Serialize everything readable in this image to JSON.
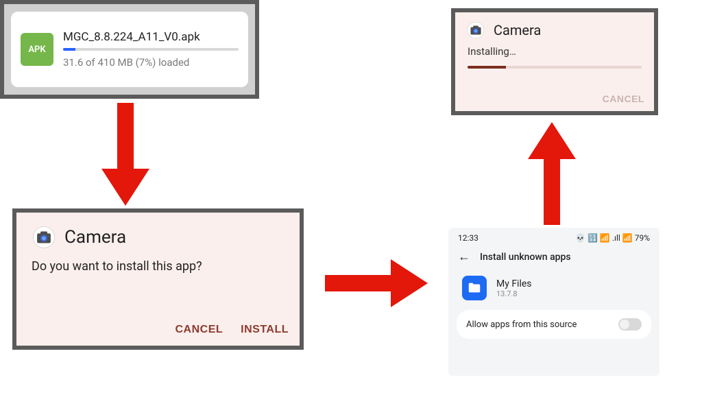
{
  "download": {
    "filename": "MGC_8.8.224_A11_V0.apk",
    "progress_pct": 7,
    "status_text": "31.6 of 410 MB (7%) loaded",
    "icon_label": "APK"
  },
  "prompt": {
    "app_name": "Camera",
    "message": "Do you want to install this app?",
    "cancel_label": "CANCEL",
    "install_label": "INSTALL"
  },
  "settings": {
    "statusbar": {
      "time": "12:33",
      "right": "💀 🔢 📶 .ıll 📶 79%"
    },
    "page_title": "Install unknown apps",
    "app": {
      "name": "My Files",
      "version": "13.7.8"
    },
    "allow_label": "Allow apps from this source",
    "allow_on": false
  },
  "installing": {
    "app_name": "Camera",
    "message": "Installing…",
    "progress_pct": 22,
    "cancel_label": "CANCEL"
  },
  "colors": {
    "accent_red": "#e3170a",
    "pink_bg": "#fbefed",
    "apk_green": "#75b74a",
    "progress_blue": "#2a63ff"
  }
}
